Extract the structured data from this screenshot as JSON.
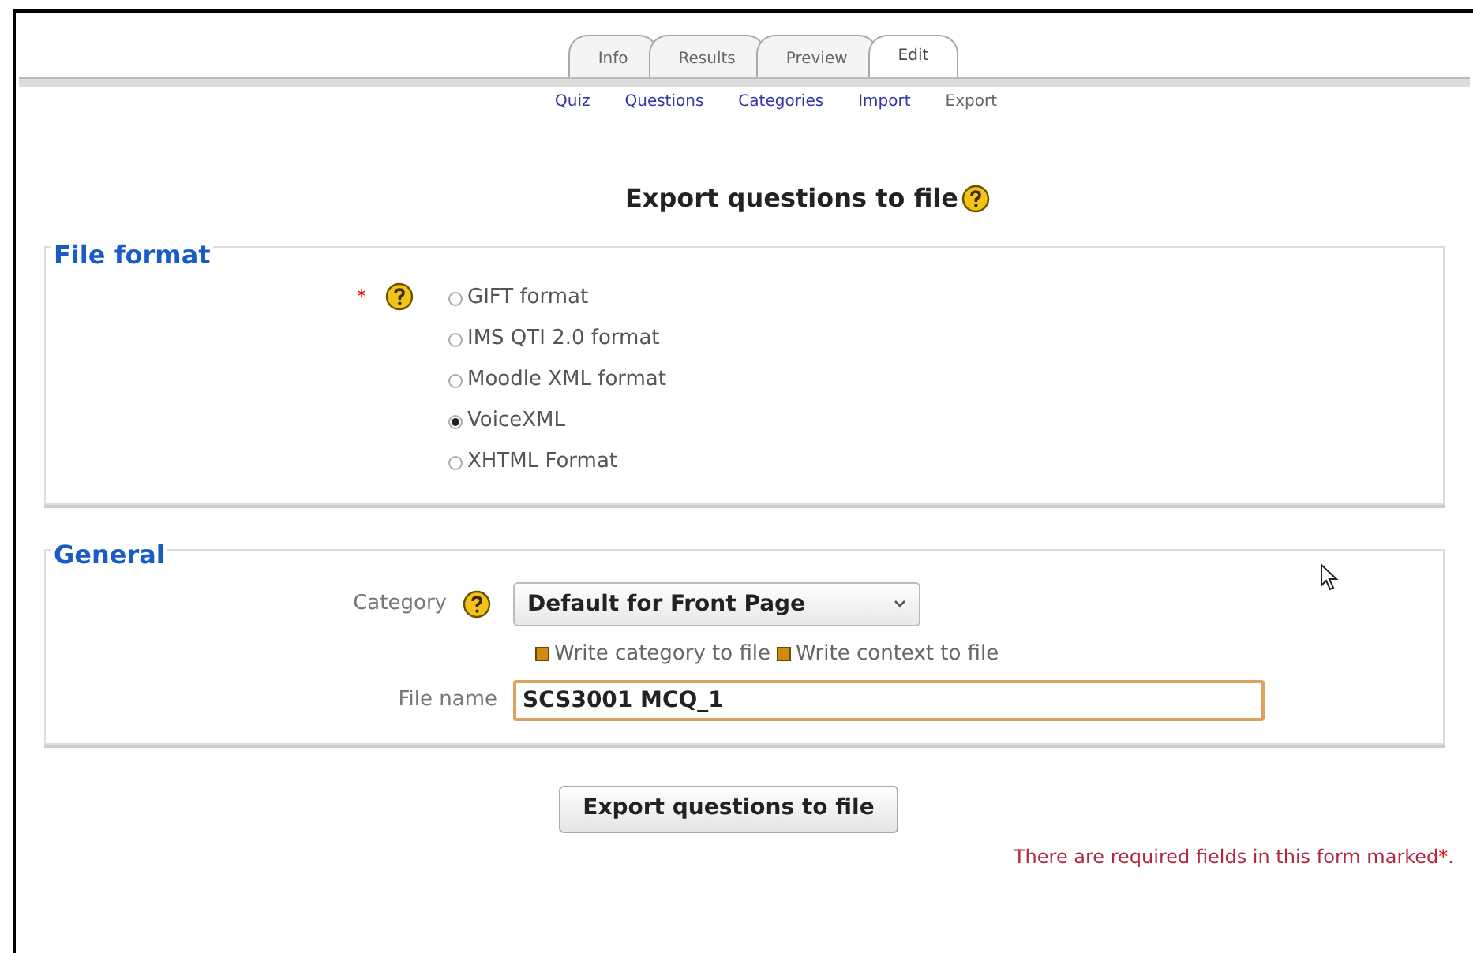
{
  "tabs": [
    {
      "label": "Info",
      "selected": false
    },
    {
      "label": "Results",
      "selected": false
    },
    {
      "label": "Preview",
      "selected": false
    },
    {
      "label": "Edit",
      "selected": true
    }
  ],
  "subtabs": [
    {
      "label": "Quiz",
      "selected": false
    },
    {
      "label": "Questions",
      "selected": false
    },
    {
      "label": "Categories",
      "selected": false
    },
    {
      "label": "Import",
      "selected": false
    },
    {
      "label": "Export",
      "selected": true
    }
  ],
  "heading": "Export questions to file",
  "file_format": {
    "legend": "File format",
    "required_mark": "*",
    "options": [
      {
        "label": "GIFT format",
        "selected": false
      },
      {
        "label": "IMS QTI 2.0 format",
        "selected": false
      },
      {
        "label": "Moodle XML format",
        "selected": false
      },
      {
        "label": "VoiceXML",
        "selected": true
      },
      {
        "label": "XHTML Format",
        "selected": false
      }
    ]
  },
  "general": {
    "legend": "General",
    "category_label": "Category",
    "category_value": "Default for Front Page",
    "checkboxes": [
      {
        "label": "Write category to file",
        "checked": true
      },
      {
        "label": "Write context to file",
        "checked": true
      }
    ],
    "file_name_label": "File name",
    "file_name_value": "SCS3001 MCQ_1"
  },
  "submit": "Export questions to file",
  "required_note": {
    "text": "There are required fields in this form marked",
    "mark": "*",
    "end": "."
  }
}
